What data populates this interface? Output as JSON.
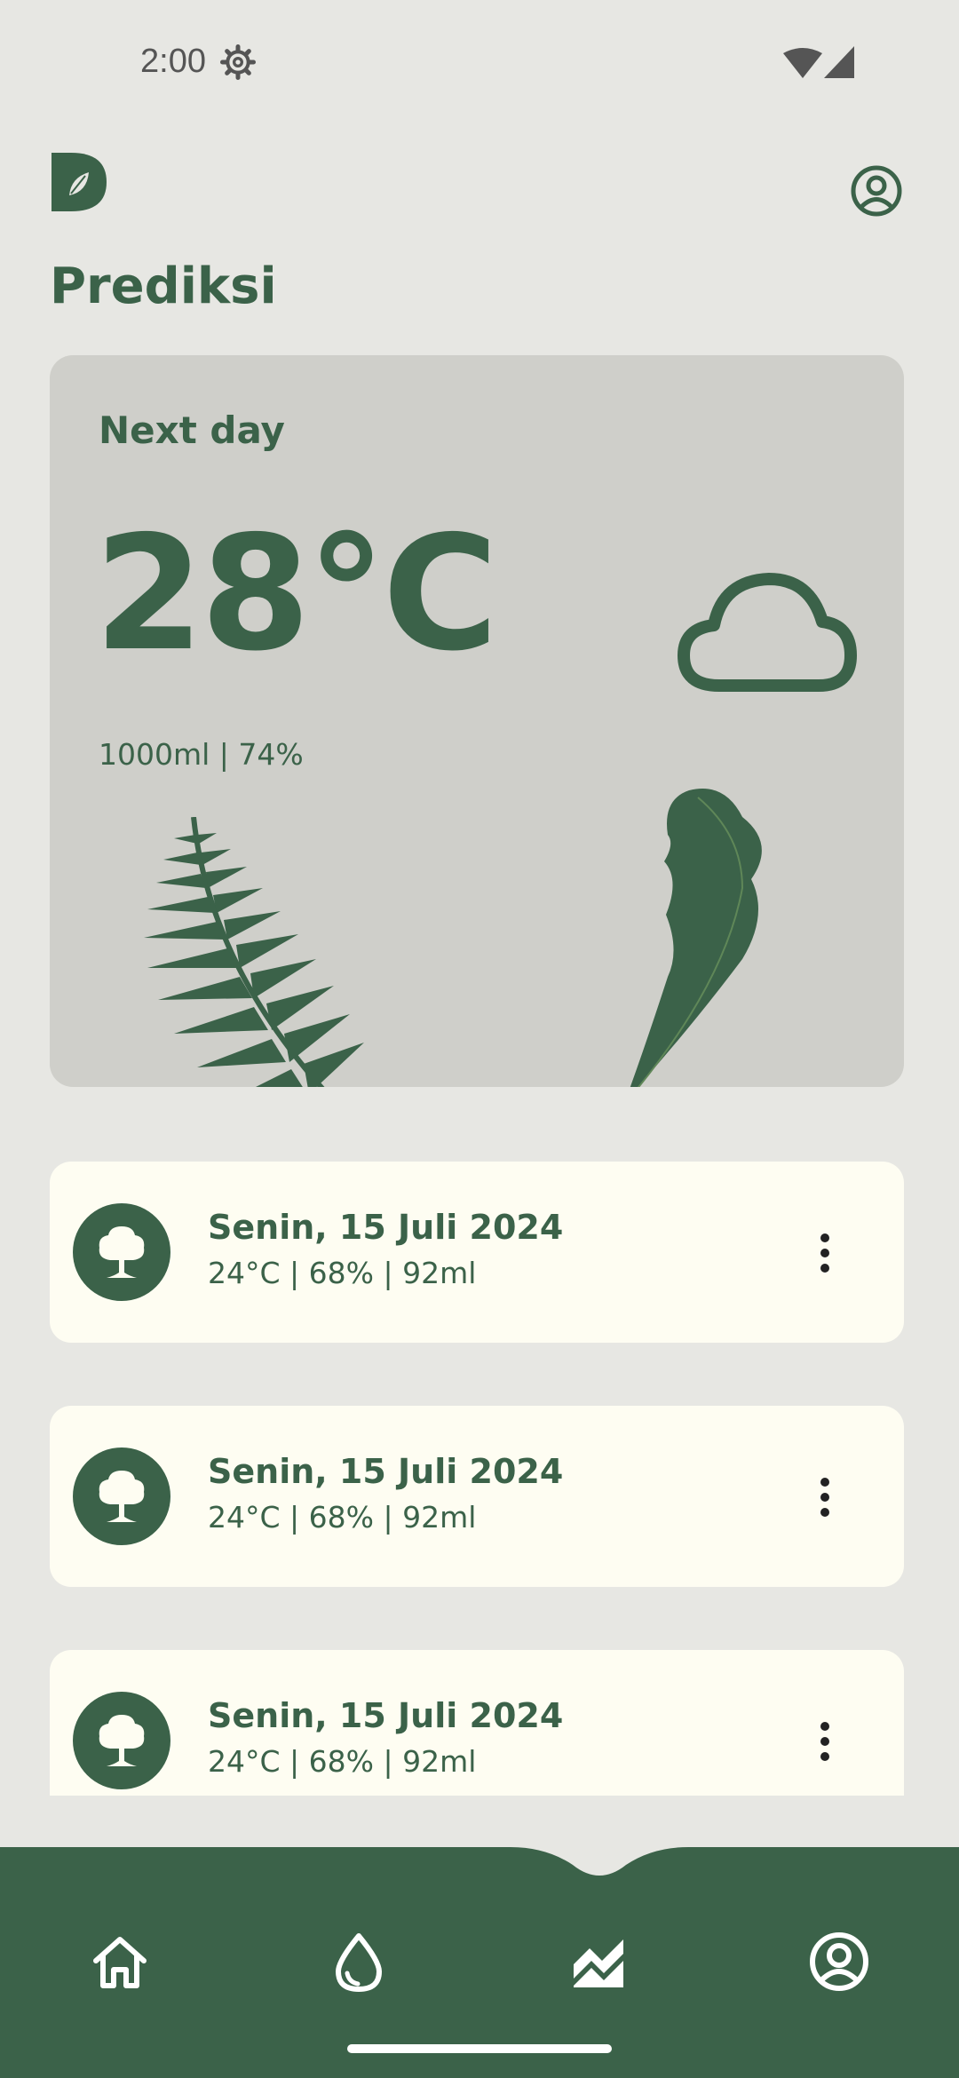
{
  "status_bar": {
    "time": "2:00"
  },
  "header": {
    "page_title": "Prediksi"
  },
  "forecast_card": {
    "label": "Next day",
    "temperature": "28°C",
    "meta": "1000ml | 74%",
    "icon": "cloud-icon"
  },
  "history": [
    {
      "date": "Senin, 15 Juli 2024",
      "meta": "24°C | 68% | 92ml",
      "icon": "tree-icon"
    },
    {
      "date": "Senin, 15 Juli 2024",
      "meta": "24°C | 68% | 92ml",
      "icon": "tree-icon"
    },
    {
      "date": "Senin, 15 Juli 2024",
      "meta": "24°C | 68% | 92ml",
      "icon": "tree-icon"
    }
  ],
  "bottom_nav": {
    "items": [
      {
        "icon": "home-icon"
      },
      {
        "icon": "water-drop-icon"
      },
      {
        "icon": "prediction-chart-icon",
        "active": true
      },
      {
        "icon": "profile-icon"
      }
    ]
  },
  "colors": {
    "primary": "#3b6249",
    "background": "#e7e7e3",
    "card": "#cfcfca",
    "list_card": "#fefdf2"
  }
}
